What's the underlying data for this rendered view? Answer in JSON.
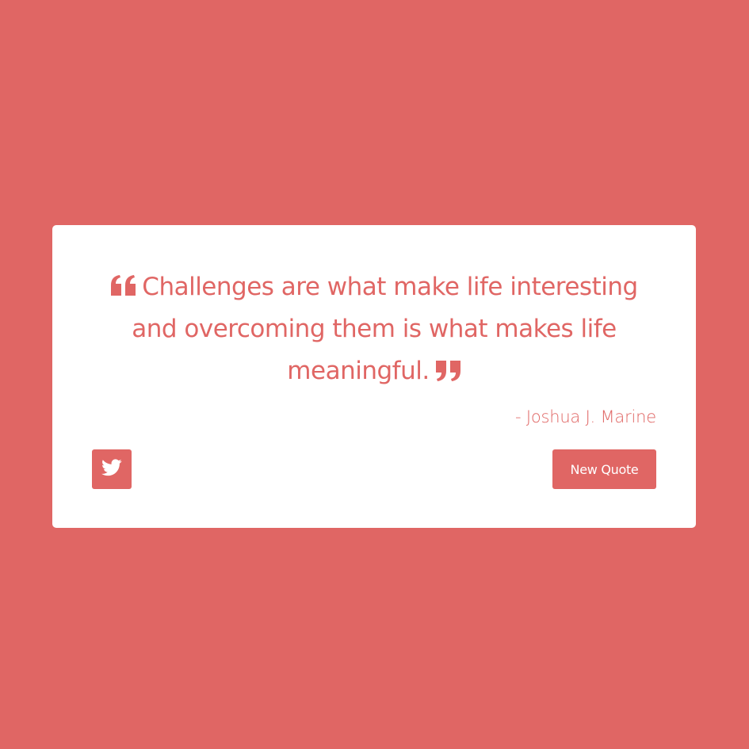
{
  "theme": {
    "accent": "#e06664",
    "card_background": "#ffffff"
  },
  "quote": {
    "text": "Challenges are what make life interesting and overcoming them is what makes life meaningful.",
    "author": "- Joshua J. Marine",
    "open_icon": "quote-left-icon",
    "close_icon": "quote-right-icon"
  },
  "actions": {
    "tweet_icon": "twitter-icon",
    "new_quote_label": "New Quote"
  }
}
